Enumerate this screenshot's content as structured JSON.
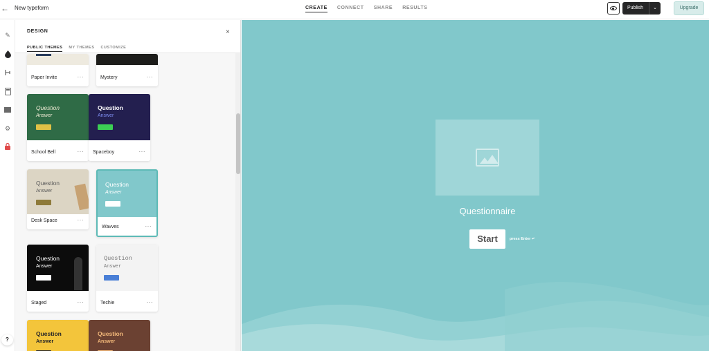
{
  "topbar": {
    "back_icon": "arrow-left-icon",
    "doc_title": "New typeform",
    "tabs": [
      {
        "label": "CREATE",
        "active": true
      },
      {
        "label": "CONNECT",
        "active": false
      },
      {
        "label": "SHARE",
        "active": false
      },
      {
        "label": "RESULTS",
        "active": false
      }
    ],
    "preview_icon": "eye-icon",
    "publish_label": "Publish",
    "publish_caret_icon": "chevron-down-icon",
    "upgrade_label": "Upgrade"
  },
  "rail": {
    "icons": [
      "pencil-icon",
      "droplet-icon",
      "logic-branch-icon",
      "calculator-icon",
      "mail-icon",
      "gear-icon",
      "lock-icon"
    ],
    "help_label": "?"
  },
  "design_panel": {
    "title": "DESIGN",
    "close_icon": "close-icon",
    "subtabs": [
      {
        "label": "PUBLIC THEMES",
        "active": true
      },
      {
        "label": "MY THEMES",
        "active": false
      },
      {
        "label": "CUSTOMIZE",
        "active": false
      }
    ],
    "themes": [
      {
        "name": "Paper Invite",
        "menu": "···"
      },
      {
        "name": "Mystery",
        "menu": "···"
      },
      {
        "name": "School Bell",
        "menu": "···",
        "question": "Question",
        "answer": "Answer",
        "bg": "#2f6b46",
        "q_color": "#f1ecd6",
        "btn": "#e0c146"
      },
      {
        "name": "Spaceboy",
        "menu": "···",
        "question": "Question",
        "answer": "Answer",
        "bg": "#231f4f",
        "q_color": "#ffffff",
        "btn": "#3ccf54"
      },
      {
        "name": "Desk Space",
        "menu": "···",
        "question": "Question",
        "answer": "Answer",
        "bg": "#dcd5c4",
        "q_color": "#5a5a5a",
        "btn": "#8e7a3a"
      },
      {
        "name": "Wavves",
        "menu": "···",
        "question": "Question",
        "answer": "Answer",
        "bg": "#81c8cb",
        "q_color": "#ffffff",
        "btn": "#ffffff",
        "selected": true
      },
      {
        "name": "Staged",
        "menu": "···",
        "question": "Question",
        "answer": "Answer",
        "bg": "#0c0c0c",
        "q_color": "#ffffff",
        "btn": "#ffffff"
      },
      {
        "name": "Techie",
        "menu": "···",
        "question": "Question",
        "answer": "Answer",
        "bg": "#f3f3f3",
        "q_color": "#7a7a7a",
        "btn": "#4a7fd6"
      },
      {
        "name": "",
        "question": "Question",
        "answer": "Answer",
        "bg": "#f3c53b",
        "q_color": "#262627",
        "btn": "#262627"
      },
      {
        "name": "",
        "question": "Question",
        "answer": "Answer",
        "bg": "#6b4132",
        "q_color": "#f3b97a",
        "btn": "#f3b97a"
      }
    ]
  },
  "canvas": {
    "background": "#81c8cb",
    "image_placeholder_icon": "image-icon",
    "welcome_title": "Questionnaire",
    "start_label": "Start",
    "press_enter": "press Enter ↵"
  }
}
